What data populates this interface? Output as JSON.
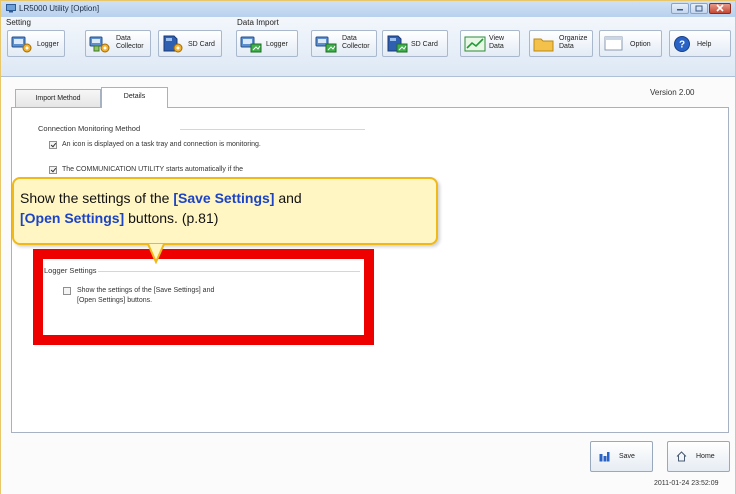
{
  "window": {
    "title": "LR5000 Utility [Option]"
  },
  "toolbar": {
    "setting_label": "Setting",
    "data_import_label": "Data Import",
    "setting_buttons": [
      {
        "label": "Logger"
      },
      {
        "label": "Data\nCollector"
      },
      {
        "label": "SD Card"
      }
    ],
    "import_buttons": [
      {
        "label": "Logger"
      },
      {
        "label": "Data\nCollector"
      },
      {
        "label": "SD Card"
      }
    ],
    "view_data": "View\nData",
    "organize_data": "Organize\nData",
    "option": "Option",
    "help": "Help"
  },
  "tabs": [
    {
      "label": "Import Method",
      "active": false
    },
    {
      "label": "Details",
      "active": true
    }
  ],
  "version": "Version   2.00",
  "connection": {
    "title": "Connection Monitoring Method",
    "option1": "An icon is displayed on a task tray and connection is monitoring.",
    "option1_checked": true,
    "option2": "The COMMUNICATION UTILITY starts automatically if the",
    "option2_checked": true
  },
  "logger_settings": {
    "title": "Logger Settings",
    "option": "Show the settings of the [Save Settings] and\n[Open Settings] buttons.",
    "checked": false
  },
  "callout": {
    "t1": "Show the settings of the ",
    "t2": "[Save Settings]",
    "t3": " and",
    "t4": "[Open Settings]",
    "t5": " buttons. (p.81)",
    "border_color": "#f0b818",
    "fill_color": "#fff6c4",
    "highlight_color": "#1b43c7"
  },
  "highlight_box_color": "#ee0000",
  "buttons": {
    "save": "Save",
    "home": "Home"
  },
  "timestamp": "2011-01-24 23:52:09"
}
